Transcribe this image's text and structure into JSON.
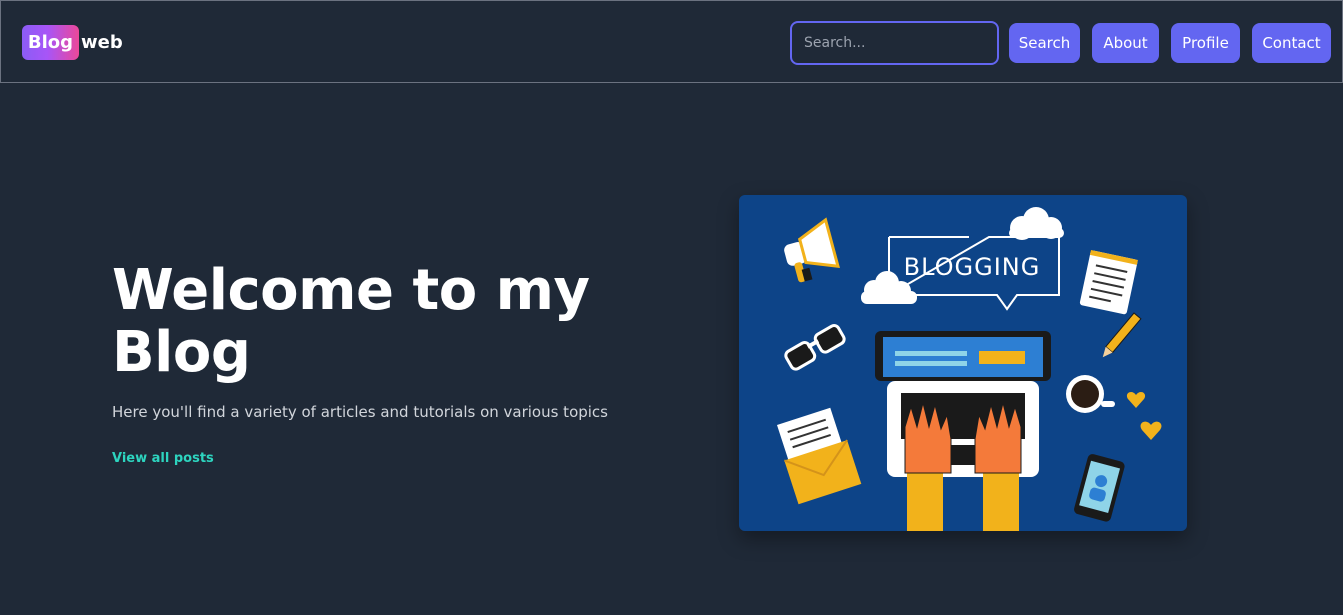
{
  "header": {
    "logo_badge": "Blog",
    "logo_rest": "web",
    "search_placeholder": "Search...",
    "buttons": {
      "search": "Search",
      "about": "About",
      "profile": "Profile",
      "contact": "Contact"
    }
  },
  "hero": {
    "title": "Welcome to my Blog",
    "subtitle": "Here you'll find a variety of articles and tutorials on various topics",
    "link": "View all posts",
    "illustration_text": "BLOGGING"
  },
  "colors": {
    "background": "#1f2937",
    "accent": "#6366f1",
    "link": "#2dd4bf",
    "illustration_bg": "#0d4488"
  }
}
